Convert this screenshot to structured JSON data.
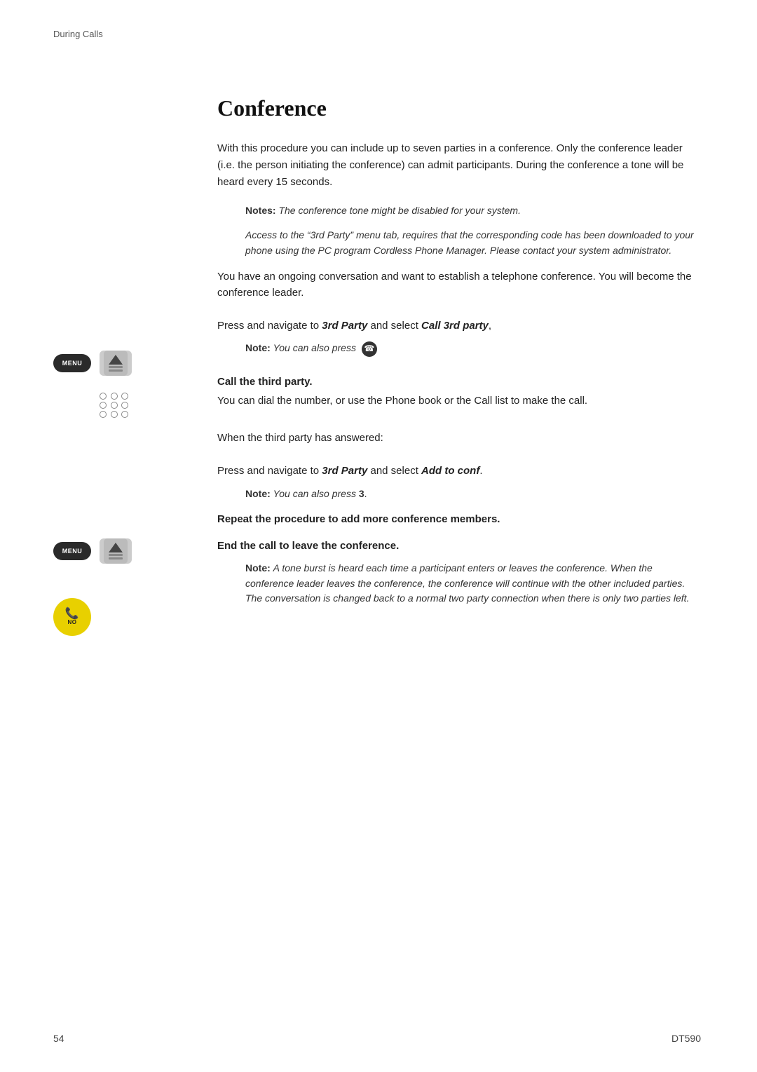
{
  "header": {
    "section_label": "During Calls"
  },
  "page": {
    "title": "Conference",
    "intro": "With this procedure you can include up to seven parties in a conference. Only the conference leader (i.e. the person initiating the conference) can admit participants. During the conference a tone will be heard every 15 seconds.",
    "note1_label": "Notes:",
    "note1_text": " The conference tone might be disabled for your system.",
    "note2_text": "Access to the “3rd Party” menu tab, requires that the corresponding code has been downloaded to your phone using the PC program Cordless Phone Manager. Please contact your system administrator.",
    "setup_text": "You have an ongoing conversation and want to establish a telephone conference. You will become the conference leader.",
    "step1_instruction_pre": "Press and navigate to ",
    "step1_bold_italic1": "3rd Party",
    "step1_instruction_mid": " and select ",
    "step1_bold_italic2": "Call 3rd party",
    "step1_instruction_end": ",",
    "step1_note_label": "Note:",
    "step1_note_text": " You can also press",
    "step2_title": "Call the third party.",
    "step2_text": "You can dial the number, or use the Phone book or the Call list to make the call.",
    "answered_text": "When the third party has answered:",
    "step3_instruction_pre": "Press and navigate to ",
    "step3_bold_italic1": "3rd Party",
    "step3_instruction_mid": " and select ",
    "step3_bold_italic2": "Add to conf",
    "step3_instruction_end": ".",
    "step3_note_label": "Note:",
    "step3_note_text": " You can also press ",
    "step3_note_bold": "3",
    "step3_note_end": ".",
    "step4_instruction": "Repeat the procedure to add more conference members.",
    "step5_instruction": "End the call to leave the conference.",
    "final_note_label": "Note:",
    "final_note_text": " A tone burst is heard each time a participant enters or leaves the conference. When the conference leader leaves the conference, the conference will continue with the other included parties. The conversation is changed back to a normal two party connection when there is only two parties left.",
    "menu_label": "MENU",
    "no_label": "NO"
  },
  "footer": {
    "page_number": "54",
    "product": "DT590"
  }
}
